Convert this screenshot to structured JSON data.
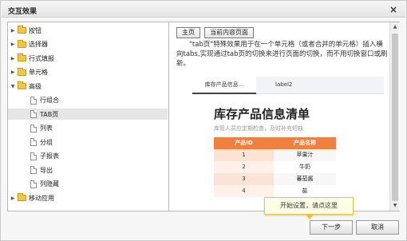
{
  "dialog": {
    "title": "交互效果",
    "close_glyph": "×"
  },
  "tree": [
    {
      "label": "按钮",
      "type": "folder",
      "state": "collapsed",
      "level": 0
    },
    {
      "label": "选择器",
      "type": "folder",
      "state": "collapsed",
      "level": 0
    },
    {
      "label": "行式填报",
      "type": "folder",
      "state": "collapsed",
      "level": 0
    },
    {
      "label": "单元格",
      "type": "folder",
      "state": "collapsed",
      "level": 0
    },
    {
      "label": "高级",
      "type": "folder",
      "state": "expanded",
      "level": 0
    },
    {
      "label": "行组合",
      "type": "file",
      "level": 1
    },
    {
      "label": "TAB页",
      "type": "file",
      "level": 1,
      "selected": true
    },
    {
      "label": "列表",
      "type": "file",
      "level": 1
    },
    {
      "label": "分组",
      "type": "file",
      "level": 1
    },
    {
      "label": "子报表",
      "type": "file",
      "level": 1
    },
    {
      "label": "导出",
      "type": "file",
      "level": 1
    },
    {
      "label": "列隐藏",
      "type": "file",
      "level": 1
    },
    {
      "label": "移动应用",
      "type": "folder",
      "state": "collapsed",
      "level": 0
    }
  ],
  "content": {
    "buttons": [
      "主页",
      "当前内容页面"
    ],
    "description": "\"tab页\"特殊效果用于在一个单元格（或者合并的单元格）插入横向tabs,实现通过tab页的切换来进行页面的切换，而不用切换窗口或刷新。",
    "preview": {
      "tabs": [
        "库存产品信息...",
        "label2"
      ],
      "title": "库存产品信息清单",
      "subtitle": "库管人员应定期检查，及时补充短缺",
      "columns": [
        "产品ID",
        "产品名称"
      ],
      "rows": [
        [
          "1",
          "苹果汁"
        ],
        [
          "2",
          "牛奶"
        ],
        [
          "3",
          "蕃茄酱"
        ],
        [
          "4",
          "盐"
        ]
      ]
    }
  },
  "tooltip": "开始设置，请点这里",
  "footer": {
    "next_label": "下一步",
    "cancel_label": "取消"
  }
}
